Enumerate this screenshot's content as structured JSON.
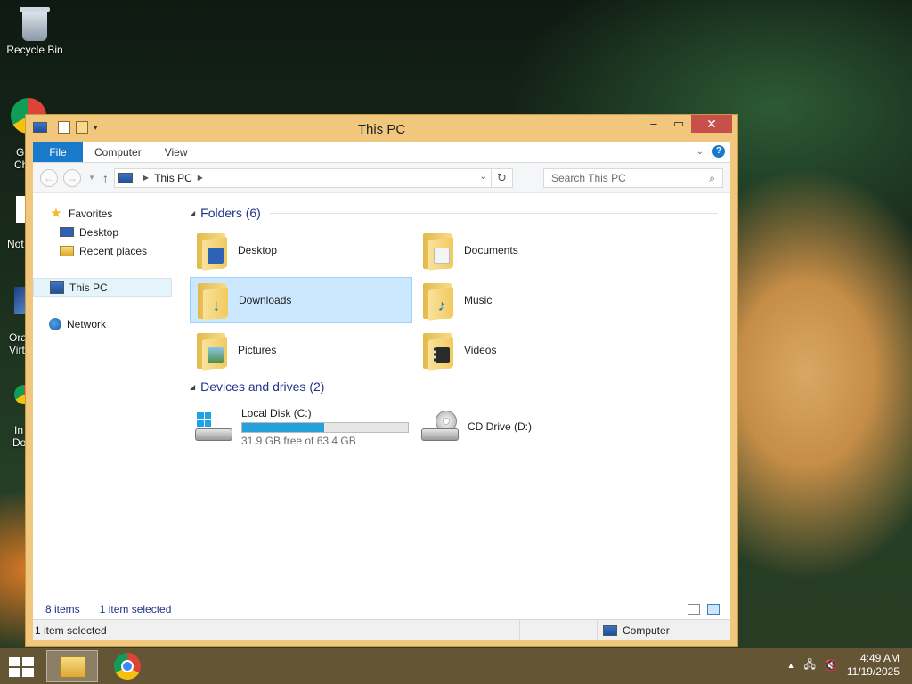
{
  "desktop": {
    "icons": [
      {
        "label": "Recycle Bin"
      }
    ],
    "partial_labels": [
      "G",
      "Ch",
      "Not",
      "Ora",
      "Virt",
      "In",
      "Do"
    ]
  },
  "window": {
    "title": "This PC",
    "ribbon_tabs": [
      "File",
      "Computer",
      "View"
    ],
    "address": {
      "path": "This PC"
    },
    "search_placeholder": "Search This PC",
    "nav": {
      "favorites": "Favorites",
      "desktop": "Desktop",
      "recent": "Recent places",
      "this_pc": "This PC",
      "network": "Network"
    },
    "folders_header": "Folders (6)",
    "folders": [
      {
        "name": "Desktop"
      },
      {
        "name": "Documents"
      },
      {
        "name": "Downloads"
      },
      {
        "name": "Music"
      },
      {
        "name": "Pictures"
      },
      {
        "name": "Videos"
      }
    ],
    "drives_header": "Devices and drives (2)",
    "drives": [
      {
        "name": "Local Disk (C:)",
        "free_text": "31.9 GB free of 63.4 GB",
        "used_fraction": 0.497
      },
      {
        "name": "CD Drive (D:)"
      }
    ],
    "status": {
      "items": "8 items",
      "selected": "1 item selected"
    },
    "statusbar": {
      "left": "1 item selected",
      "right": "Computer"
    }
  },
  "taskbar": {
    "time": "4:49 AM",
    "date": "11/19/2025"
  },
  "colors": {
    "accent": "#1979ca",
    "selection": "#cce8ff",
    "window_frame": "#f0c77c",
    "close": "#c7504b"
  }
}
